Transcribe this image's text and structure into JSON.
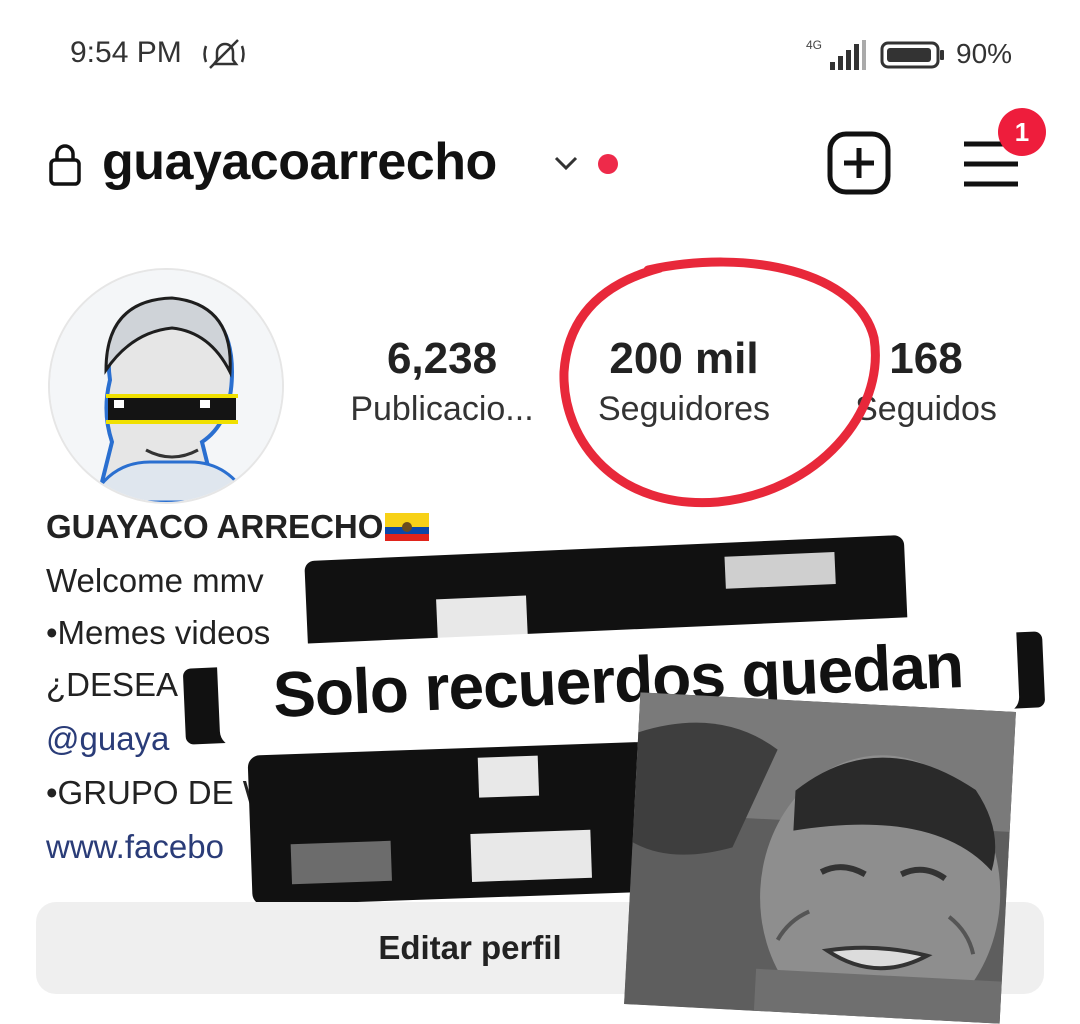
{
  "status_bar": {
    "time": "9:54 PM",
    "network": "4G",
    "battery": "90%",
    "icons": [
      "mute-icon",
      "signal-icon",
      "battery-icon"
    ]
  },
  "header": {
    "username": "guayacoarrecho",
    "notification_count": "1",
    "icons": [
      "lock-icon",
      "chevron-down-icon",
      "add-icon",
      "menu-icon"
    ]
  },
  "stats": {
    "posts": {
      "value": "6,238",
      "label": "Publicacio..."
    },
    "followers": {
      "value": "200 mil",
      "label": "Seguidores"
    },
    "following": {
      "value": "168",
      "label": "Seguidos"
    }
  },
  "bio": {
    "name": "GUAYACO ARRECHO",
    "line1": "Welcome mmv",
    "line2": "•Memes videos",
    "line3": "¿DESEA",
    "line4": "@guaya",
    "line5": "•GRUPO DE WAZAP",
    "line6": "www.facebo",
    "ellipsis": "..."
  },
  "caption": "Solo recuerdos quedan",
  "edit_button": "Editar perfil",
  "colors": {
    "accent_red": "#ee2a4a",
    "circle_red": "#e8283a",
    "link": "#2a3c78",
    "button_bg": "#efefef"
  }
}
